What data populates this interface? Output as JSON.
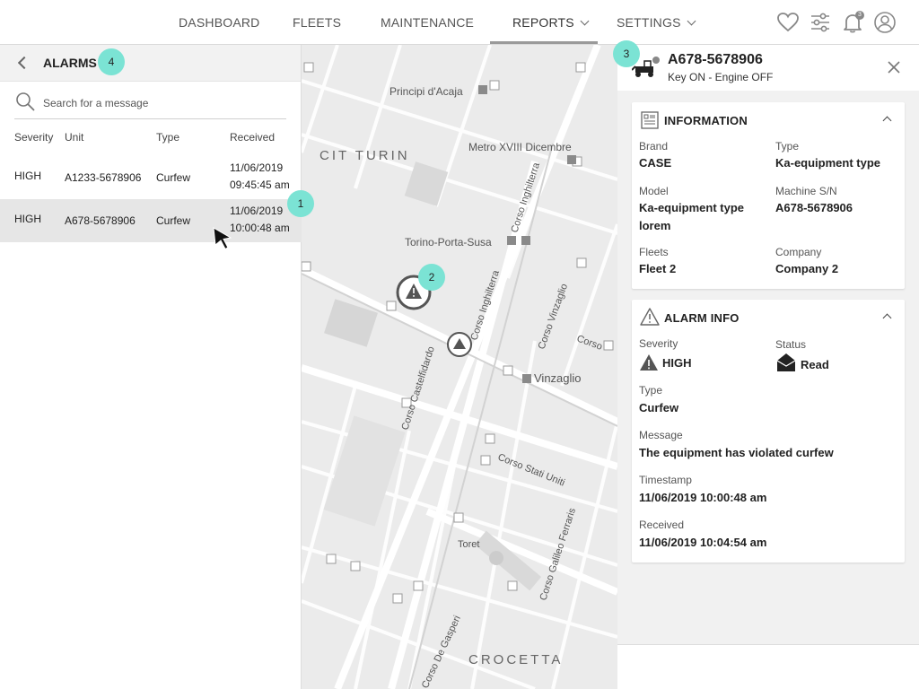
{
  "nav": {
    "items": [
      "DASHBOARD",
      "FLEETS",
      "MAINTENANCE",
      "REPORTS",
      "SETTINGS"
    ],
    "active": "REPORTS",
    "notification_count": "3"
  },
  "alarms": {
    "title": "ALARMS",
    "search_placeholder": "Search for a message",
    "columns": [
      "Severity",
      "Unit",
      "Type",
      "Received"
    ],
    "rows": [
      {
        "severity": "HIGH",
        "unit": "A1233-5678906",
        "type": "Curfew",
        "date": "11/06/2019",
        "time": "09:45:45 am"
      },
      {
        "severity": "HIGH",
        "unit": "A678-5678906",
        "type": "Curfew",
        "date": "11/06/2019",
        "time": "10:00:48 am"
      }
    ]
  },
  "markers": [
    "1",
    "2",
    "3",
    "4"
  ],
  "map": {
    "labels": [
      "Principi d'Acaja",
      "CIT TURIN",
      "Metro XVIII Dicembre",
      "Torino-Porta-Susa",
      "Corso Inghilterra",
      "Corso Inghilterra",
      "Corso Vinzaglio",
      "Corso Castelfidardo",
      "Vinzaglio",
      "Corso Stati Uniti",
      "Toret",
      "Corso Galileo Ferraris",
      "CROCETTA",
      "Corso De Gasperi",
      "Corso"
    ]
  },
  "detail": {
    "unit_id": "A678-5678906",
    "status_line": "Key ON - Engine OFF",
    "information": {
      "title": "INFORMATION",
      "brand_label": "Brand",
      "brand": "CASE",
      "type_label": "Type",
      "type": "Ka-equipment type",
      "model_label": "Model",
      "model_line1": "Ka-equipment type",
      "model_line2": "lorem",
      "serial_label": "Machine S/N",
      "serial": "A678-5678906",
      "fleets_label": "Fleets",
      "fleets": "Fleet 2",
      "company_label": "Company",
      "company": "Company 2"
    },
    "alarm_info": {
      "title": "ALARM INFO",
      "severity_label": "Severity",
      "severity": "HIGH",
      "status_label": "Status",
      "status": "Read",
      "type_label": "Type",
      "type": "Curfew",
      "message_label": "Message",
      "message": "The equipment has violated curfew",
      "timestamp_label": "Timestamp",
      "timestamp": "11/06/2019 10:00:48 am",
      "received_label": "Received",
      "received": "11/06/2019 10:04:54 am"
    }
  },
  "colors": {
    "marker": "#7be3d4",
    "selected_row": "#e6e6e6",
    "map_bg": "#ebebeb"
  },
  "icons": [
    "heart-icon",
    "sliders-icon",
    "bell-icon",
    "user-icon",
    "search-icon",
    "back-icon",
    "alarm-warning-icon",
    "machine-icon",
    "close-icon",
    "information-icon",
    "warning-icon",
    "envelope-open-icon"
  ]
}
